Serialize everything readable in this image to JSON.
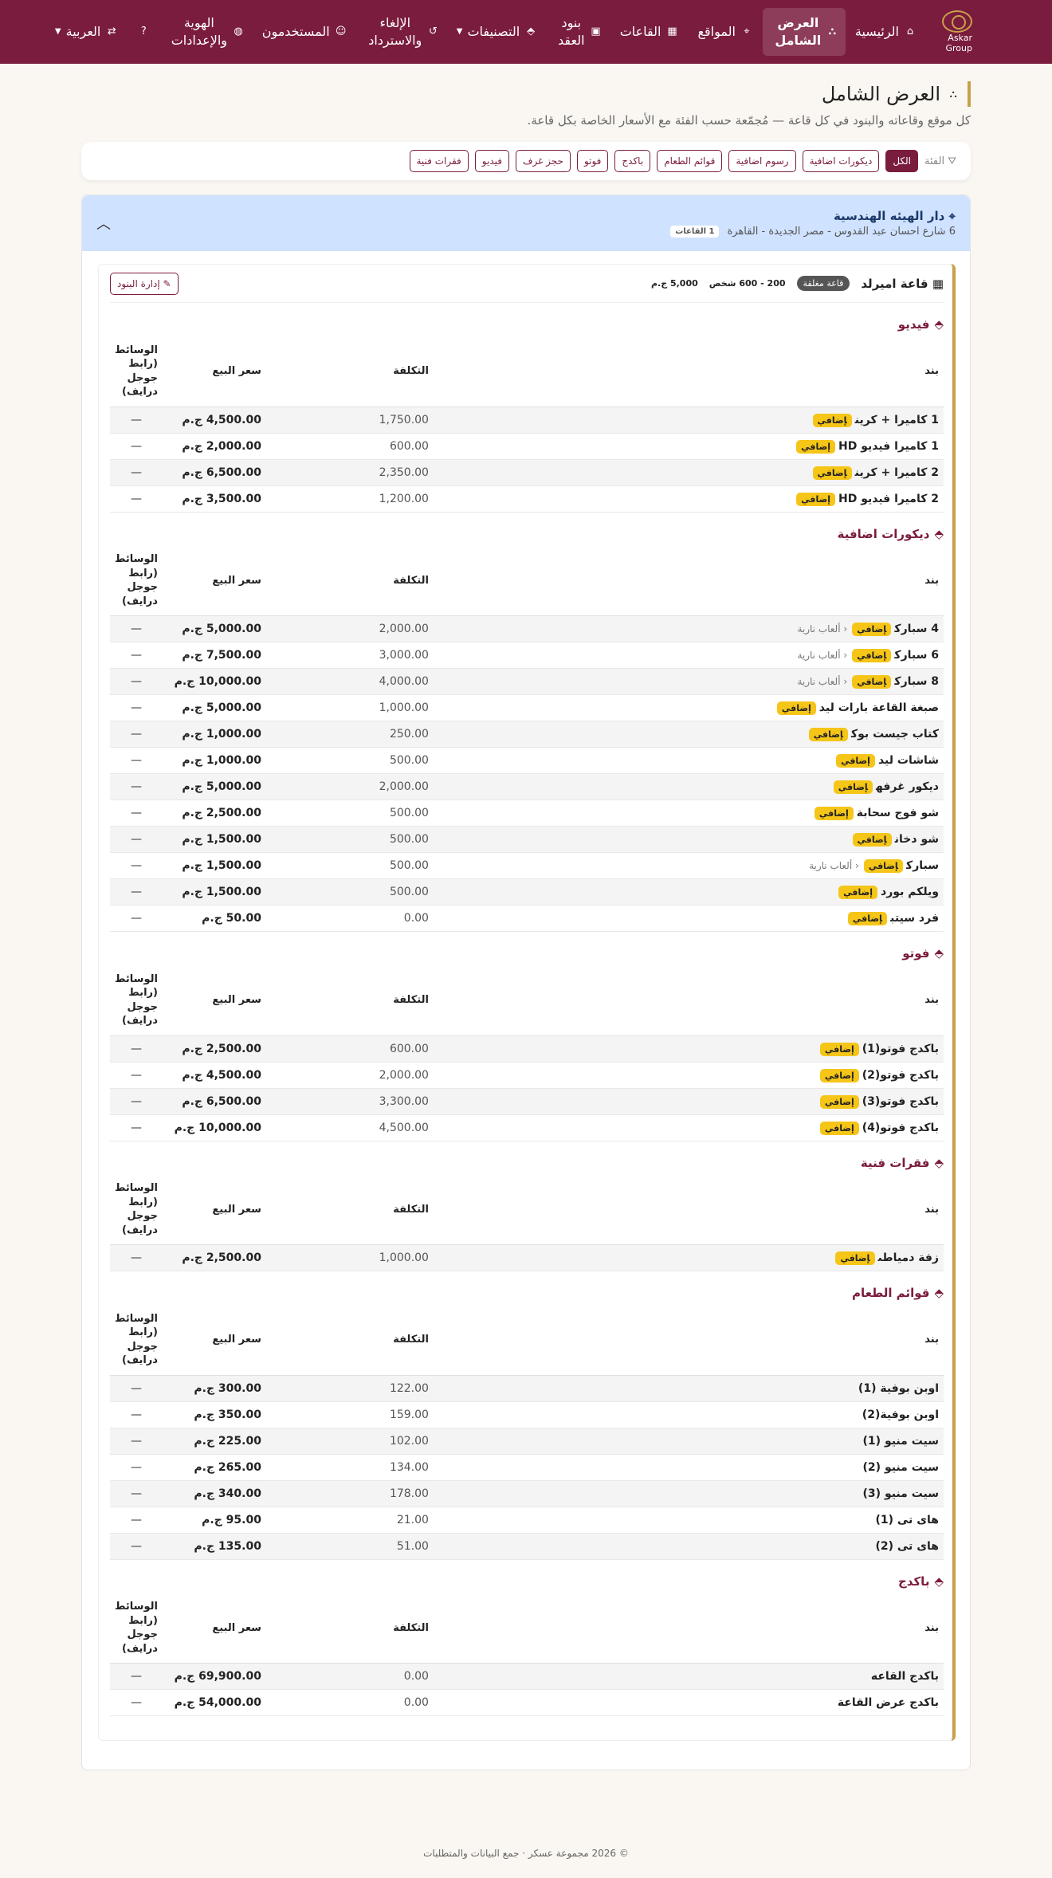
{
  "nav": {
    "brand": "Askar Group",
    "items": [
      {
        "label": "الرئيسية",
        "icon": "home-icon"
      },
      {
        "label": "العرض الشامل",
        "icon": "sitemap-icon",
        "active": true
      },
      {
        "label": "المواقع",
        "icon": "location-icon"
      },
      {
        "label": "القاعات",
        "icon": "building-icon"
      },
      {
        "label": "بنود العقد",
        "icon": "box-icon"
      },
      {
        "label": "التصنيفات",
        "icon": "tag-icon",
        "caret": true
      },
      {
        "label": "الإلغاء والاسترداد",
        "icon": "undo-icon"
      },
      {
        "label": "المستخدمون",
        "icon": "users-icon"
      },
      {
        "label": "الهوية والإعدادات",
        "icon": "palette-icon"
      }
    ],
    "help_icon": "help-icon",
    "language": "العربية"
  },
  "page": {
    "title": "العرض الشامل",
    "subtitle": "كل موقع وقاعاته والبنود في كل قاعة — مُجمّعة حسب الفئة مع الأسعار الخاصة بكل قاعة."
  },
  "filter": {
    "label": "الفئة",
    "chips": [
      "الكل",
      "ديكورات اضافية",
      "رسوم اضافية",
      "قوائم الطعام",
      "باكدج",
      "فوتو",
      "حجز غرف",
      "فيديو",
      "فقرات فنية"
    ]
  },
  "site": {
    "name": "دار الهيئه الهندسية",
    "address": "6 شارع احسان عبد القدوس - مصر الجديدة - القاهرة",
    "halls_count": "1 القاعات"
  },
  "hall": {
    "name": "قاعة اميرلد",
    "status": "قاعة مغلقة",
    "capacity": "200 - 600 شخص",
    "price": "5,000 ج.م",
    "manage_label": "إدارة البنود"
  },
  "columns": {
    "item": "بند",
    "cost": "التكلفة",
    "sell": "سعر البيع",
    "media": "الوسائط (رابط جوجل درايف)"
  },
  "extra_tag": "إضافي",
  "categories": [
    {
      "name": "فيديو",
      "rows": [
        {
          "item": "1 كاميرا + كرين",
          "tag": true,
          "cost": "1,750.00",
          "sell": "4,500.00 ج.م",
          "media": "—"
        },
        {
          "item": "1 كاميرا فيديو HD",
          "tag": true,
          "cost": "600.00",
          "sell": "2,000.00 ج.م",
          "media": "—"
        },
        {
          "item": "2 كاميرا + كرين",
          "tag": true,
          "cost": "2,350.00",
          "sell": "6,500.00 ج.م",
          "media": "—"
        },
        {
          "item": "2 كاميرا فيديو HD",
          "tag": true,
          "cost": "1,200.00",
          "sell": "3,500.00 ج.م",
          "media": "—"
        }
      ]
    },
    {
      "name": "ديكورات اضافية",
      "rows": [
        {
          "item": "4 سبارك",
          "tag": true,
          "sub": "ألعاب نارية",
          "cost": "2,000.00",
          "sell": "5,000.00 ج.م",
          "media": "—"
        },
        {
          "item": "6 سبارك",
          "tag": true,
          "sub": "ألعاب نارية",
          "cost": "3,000.00",
          "sell": "7,500.00 ج.م",
          "media": "—"
        },
        {
          "item": "8 سبارك",
          "tag": true,
          "sub": "ألعاب نارية",
          "cost": "4,000.00",
          "sell": "10,000.00 ج.م",
          "media": "—"
        },
        {
          "item": "صبغة القاعة بارات ليد",
          "tag": true,
          "cost": "1,000.00",
          "sell": "5,000.00 ج.م",
          "media": "—"
        },
        {
          "item": "كتاب جيست بوك",
          "tag": true,
          "cost": "250.00",
          "sell": "1,000.00 ج.م",
          "media": "—"
        },
        {
          "item": "شاشات ليد",
          "tag": true,
          "cost": "500.00",
          "sell": "1,000.00 ج.م",
          "media": "—"
        },
        {
          "item": "ديكور غرفه",
          "tag": true,
          "cost": "2,000.00",
          "sell": "5,000.00 ج.م",
          "media": "—"
        },
        {
          "item": "شو فوج سحابة",
          "tag": true,
          "cost": "500.00",
          "sell": "2,500.00 ج.م",
          "media": "—"
        },
        {
          "item": "شو دخان",
          "tag": true,
          "cost": "500.00",
          "sell": "1,500.00 ج.م",
          "media": "—"
        },
        {
          "item": "سبارك",
          "tag": true,
          "sub": "ألعاب نارية",
          "cost": "500.00",
          "sell": "1,500.00 ج.م",
          "media": "—"
        },
        {
          "item": "ويلكم بورد",
          "tag": true,
          "cost": "500.00",
          "sell": "1,500.00 ج.م",
          "media": "—"
        },
        {
          "item": "فرد سيتب",
          "tag": true,
          "cost": "0.00",
          "sell": "50.00 ج.م",
          "media": "—"
        }
      ]
    },
    {
      "name": "فوتو",
      "rows": [
        {
          "item": "باكدج فوتو(1)",
          "tag": true,
          "cost": "600.00",
          "sell": "2,500.00 ج.م",
          "media": "—"
        },
        {
          "item": "باكدج فوتو(2)",
          "tag": true,
          "cost": "2,000.00",
          "sell": "4,500.00 ج.م",
          "media": "—"
        },
        {
          "item": "باكدج فوتو(3)",
          "tag": true,
          "cost": "3,300.00",
          "sell": "6,500.00 ج.م",
          "media": "—"
        },
        {
          "item": "باكدج فوتو(4)",
          "tag": true,
          "cost": "4,500.00",
          "sell": "10,000.00 ج.م",
          "media": "—"
        }
      ]
    },
    {
      "name": "فقرات فنية",
      "rows": [
        {
          "item": "زفة دمياطى",
          "tag": true,
          "cost": "1,000.00",
          "sell": "2,500.00 ج.م",
          "media": "—"
        }
      ]
    },
    {
      "name": "قوائم الطعام",
      "rows": [
        {
          "item": "اوبن بوفية (1)",
          "tag": false,
          "cost": "122.00",
          "sell": "300.00 ج.م",
          "media": "—"
        },
        {
          "item": "اوبن بوفية(2)",
          "tag": false,
          "cost": "159.00",
          "sell": "350.00 ج.م",
          "media": "—"
        },
        {
          "item": "سيت منيو (1)",
          "tag": false,
          "cost": "102.00",
          "sell": "225.00 ج.م",
          "media": "—"
        },
        {
          "item": "سيت منيو (2)",
          "tag": false,
          "cost": "134.00",
          "sell": "265.00 ج.م",
          "media": "—"
        },
        {
          "item": "سيت منيو (3)",
          "tag": false,
          "cost": "178.00",
          "sell": "340.00 ج.م",
          "media": "—"
        },
        {
          "item": "هاى تى (1)",
          "tag": false,
          "cost": "21.00",
          "sell": "95.00 ج.م",
          "media": "—"
        },
        {
          "item": "هاى تى (2)",
          "tag": false,
          "cost": "51.00",
          "sell": "135.00 ج.م",
          "media": "—"
        }
      ]
    },
    {
      "name": "باكدج",
      "rows": [
        {
          "item": "باكدج القاعه",
          "tag": false,
          "cost": "0.00",
          "sell": "69,900.00 ج.م",
          "media": "—"
        },
        {
          "item": "باكدج عرض القاعة",
          "tag": false,
          "cost": "0.00",
          "sell": "54,000.00 ج.م",
          "media": "—"
        }
      ]
    }
  ],
  "footer": "© 2026 مجموعة عسكر · جمع البيانات والمتطلبات"
}
